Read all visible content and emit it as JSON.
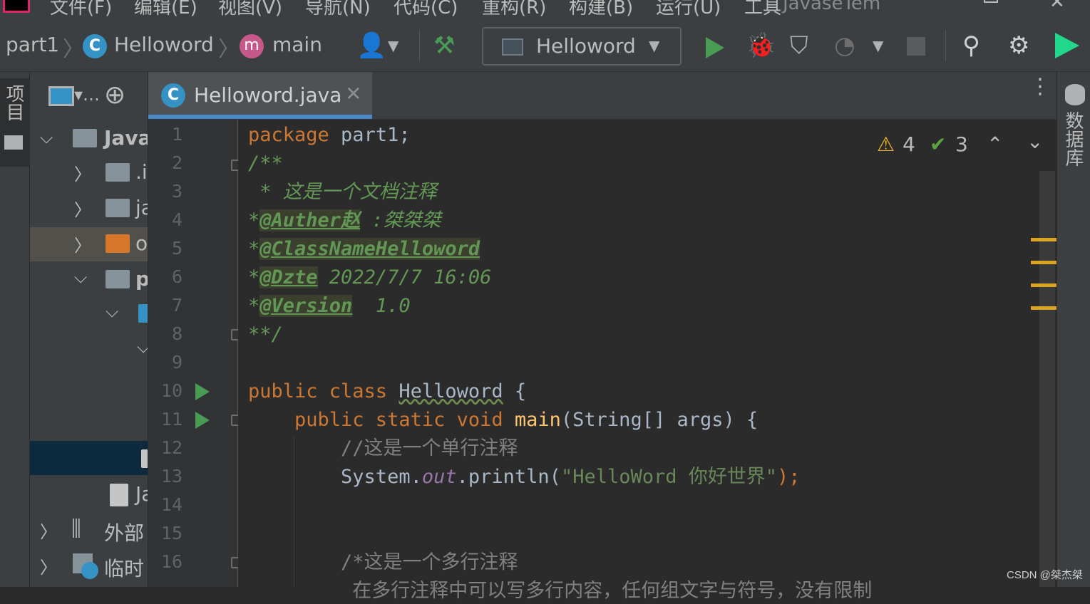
{
  "menubar": {
    "items": [
      "文件(F)",
      "编辑(E)",
      "视图(V)",
      "导航(N)",
      "代码(C)",
      "重构(R)",
      "构建(B)",
      "运行(U)",
      "工具",
      "JavaseTem"
    ]
  },
  "navbar": {
    "project": "part1",
    "file": "Helloword",
    "method": "main",
    "run_config": "Helloword"
  },
  "project_panel": {
    "rows": [
      {
        "label": "Java"
      },
      {
        "label": ".i"
      },
      {
        "label": "ja"
      },
      {
        "label": "o"
      },
      {
        "label": "p"
      },
      {
        "label": ""
      },
      {
        "label": ""
      },
      {
        "label": ""
      },
      {
        "label": "Ja"
      },
      {
        "label": "外部"
      },
      {
        "label": "临时"
      }
    ]
  },
  "left_strip": {
    "tab_label": "项目"
  },
  "right_strip": {
    "tab_label": "数据库"
  },
  "tabs": [
    {
      "label": "Helloword.java"
    }
  ],
  "inspections": {
    "warnings": "4",
    "weak_warnings": "3"
  },
  "editor": {
    "line_numbers": [
      "1",
      "2",
      "3",
      "4",
      "5",
      "6",
      "7",
      "8",
      "9",
      "10",
      "11",
      "12",
      "13",
      "14",
      "15",
      "16"
    ],
    "lines": {
      "l1_kw": "package",
      "l1_rest": " part1;",
      "l2": "/**",
      "l3": " * 这是一个文档注释",
      "l4_star": "*",
      "l4_tag": "@Auther赵",
      "l4_rest": " :桀桀桀",
      "l5_star": "*",
      "l5_tag": "@ClassNameHelloword",
      "l6_star": "*",
      "l6_tag": "@Dzte",
      "l6_rest": " 2022/7/7 16:06",
      "l7_star": "*",
      "l7_tag": "@Version",
      "l7_rest": "  1.0",
      "l8": "**/",
      "l10_kw": "public class ",
      "l10_name": "Helloword",
      "l10_rest": " {",
      "l11_kw": "    public static void ",
      "l11_fn": "main",
      "l11_rest": "(String[] args) {",
      "l12": "        //这是一个单行注释",
      "l13_a": "        System.",
      "l13_out": "out",
      "l13_b": ".println(",
      "l13_str": "\"HelloWord 你好世界\"",
      "l13_c": ");",
      "l16": "        /*这是一个多行注释",
      "l17": "         在多行注释中可以写多行内容，任何组文字与符号，没有限制"
    }
  },
  "watermark": "CSDN @桀杰桀"
}
